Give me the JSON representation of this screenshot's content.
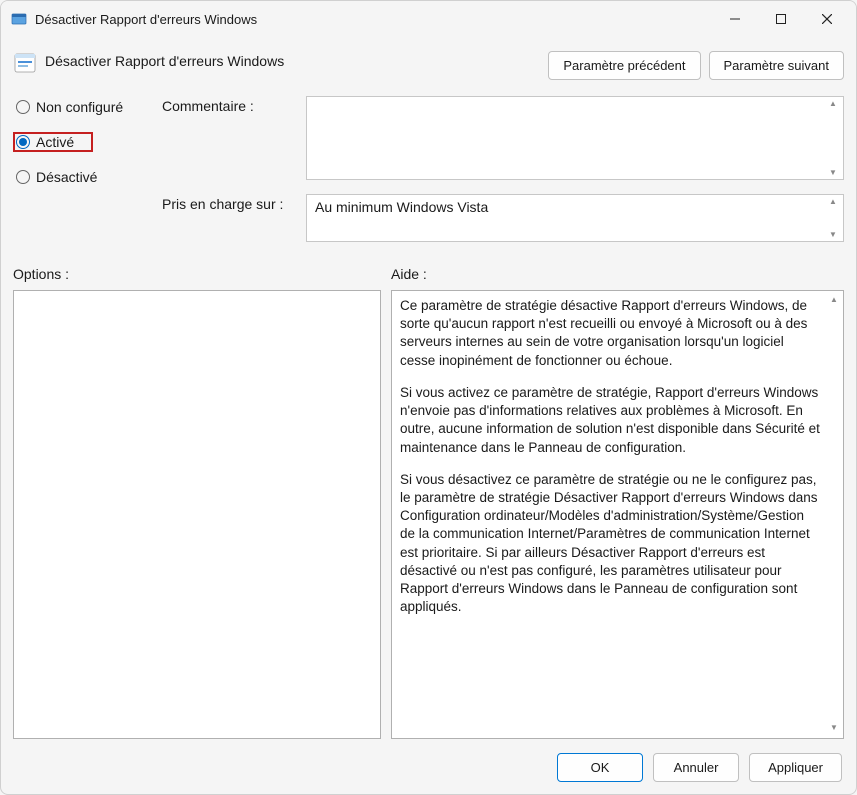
{
  "window": {
    "title": "Désactiver Rapport d'erreurs Windows"
  },
  "header": {
    "policyTitle": "Désactiver Rapport d'erreurs Windows",
    "prevBtn": "Paramètre précédent",
    "nextBtn": "Paramètre suivant"
  },
  "state": {
    "notConfigured": "Non configuré",
    "enabled": "Activé",
    "disabled": "Désactivé",
    "selected": "enabled"
  },
  "labels": {
    "comment": "Commentaire :",
    "supportedOn": "Pris en charge sur :",
    "options": "Options :",
    "help": "Aide :"
  },
  "supportedText": "Au minimum Windows Vista",
  "help": {
    "p1": "Ce paramètre de stratégie désactive Rapport d'erreurs Windows, de sorte qu'aucun rapport n'est recueilli ou envoyé à Microsoft ou à des serveurs internes au sein de votre organisation lorsqu'un logiciel cesse inopinément de fonctionner ou échoue.",
    "p2": "Si vous activez ce paramètre de stratégie, Rapport d'erreurs Windows n'envoie pas d'informations relatives aux problèmes à Microsoft. En outre, aucune information de solution n'est disponible dans Sécurité et maintenance dans le Panneau de configuration.",
    "p3": "Si vous désactivez ce paramètre de stratégie ou ne le configurez pas, le paramètre de stratégie Désactiver Rapport d'erreurs Windows dans Configuration ordinateur/Modèles d'administration/Système/Gestion de la communication Internet/Paramètres de communication Internet est prioritaire. Si par ailleurs Désactiver Rapport d'erreurs est désactivé ou n'est pas configuré, les paramètres utilisateur pour Rapport d'erreurs Windows dans le Panneau de configuration sont appliqués."
  },
  "footer": {
    "ok": "OK",
    "cancel": "Annuler",
    "apply": "Appliquer"
  }
}
